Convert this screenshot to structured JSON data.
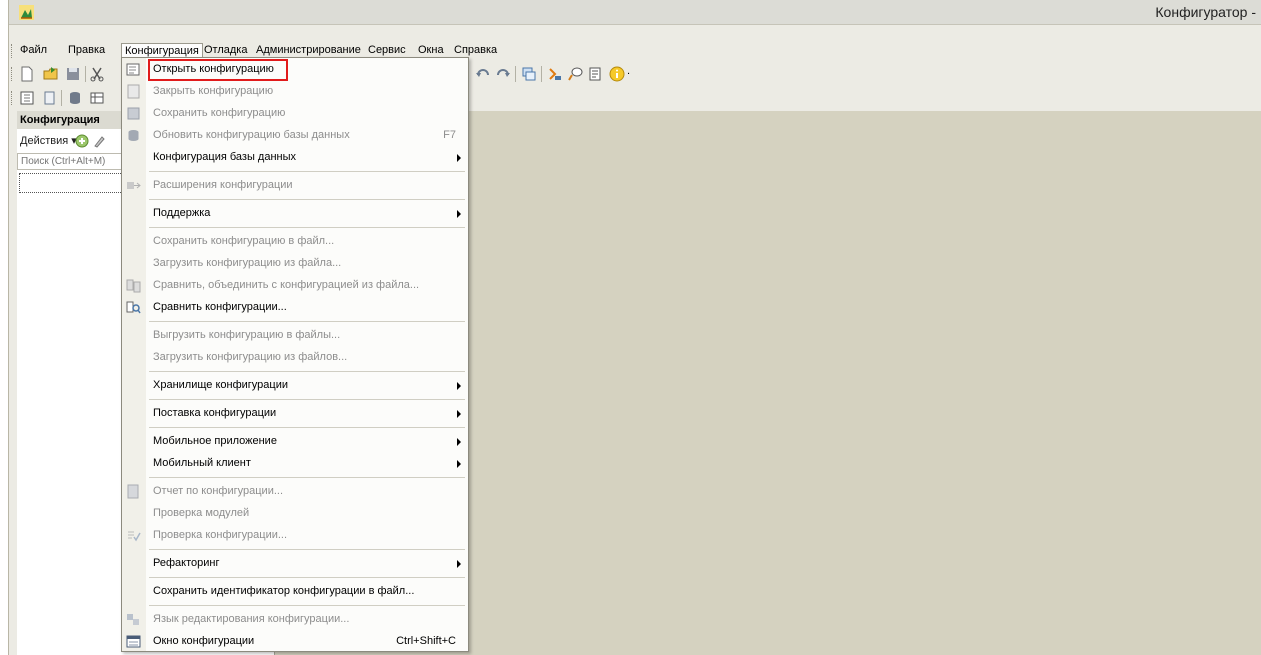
{
  "window": {
    "title": "Конфигуратор -"
  },
  "menubar": {
    "items": [
      "Файл",
      "Правка",
      "Конфигурация",
      "Отладка",
      "Администрирование",
      "Сервис",
      "Окна",
      "Справка"
    ]
  },
  "left_panel": {
    "title": "Конфигурация",
    "actions_label": "Действия ▾",
    "search_placeholder": "Поиск (Ctrl+Alt+M)"
  },
  "menu": {
    "items": [
      {
        "label": "Открыть конфигурацию",
        "icon": "open-config-icon",
        "enabled": true
      },
      {
        "label": "Закрыть конфигурацию",
        "icon": "close-config-icon",
        "enabled": false
      },
      {
        "label": "Сохранить конфигурацию",
        "icon": "save-config-icon",
        "enabled": false
      },
      {
        "label": "Обновить конфигурацию базы данных",
        "icon": "update-db-icon",
        "enabled": false,
        "shortcut": "F7"
      },
      {
        "label": "Конфигурация базы данных",
        "enabled": true,
        "submenu": true
      },
      {
        "label": "Расширения конфигурации",
        "icon": "extensions-icon",
        "enabled": false
      },
      {
        "label": "Поддержка",
        "enabled": true,
        "submenu": true
      },
      {
        "label": "Сохранить конфигурацию в файл...",
        "enabled": false
      },
      {
        "label": "Загрузить конфигурацию из файла...",
        "enabled": false
      },
      {
        "label": "Сравнить, объединить с конфигурацией из файла...",
        "icon": "merge-icon",
        "enabled": false
      },
      {
        "label": "Сравнить конфигурации...",
        "icon": "compare-icon",
        "enabled": true
      },
      {
        "label": "Выгрузить конфигурацию в файлы...",
        "enabled": false
      },
      {
        "label": "Загрузить конфигурацию из файлов...",
        "enabled": false
      },
      {
        "label": "Хранилище конфигурации",
        "enabled": true,
        "submenu": true
      },
      {
        "label": "Поставка конфигурации",
        "enabled": true,
        "submenu": true
      },
      {
        "label": "Мобильное приложение",
        "enabled": true,
        "submenu": true
      },
      {
        "label": "Мобильный клиент",
        "enabled": true,
        "submenu": true
      },
      {
        "label": "Отчет по конфигурации...",
        "icon": "report-icon",
        "enabled": false
      },
      {
        "label": "Проверка модулей",
        "enabled": false
      },
      {
        "label": "Проверка конфигурации...",
        "icon": "check-icon",
        "enabled": false
      },
      {
        "label": "Рефакторинг",
        "enabled": true,
        "submenu": true
      },
      {
        "label": "Сохранить идентификатор конфигурации в файл...",
        "enabled": true
      },
      {
        "label": "Язык редактирования конфигурации...",
        "icon": "language-icon",
        "enabled": false
      },
      {
        "label": "Окно конфигурации",
        "icon": "config-window-icon",
        "enabled": true,
        "shortcut": "Ctrl+Shift+C"
      }
    ]
  },
  "colors": {
    "highlight": "#e11b1b",
    "workspace": "#d5d2c0",
    "disabled_text": "#8d8d8d"
  }
}
